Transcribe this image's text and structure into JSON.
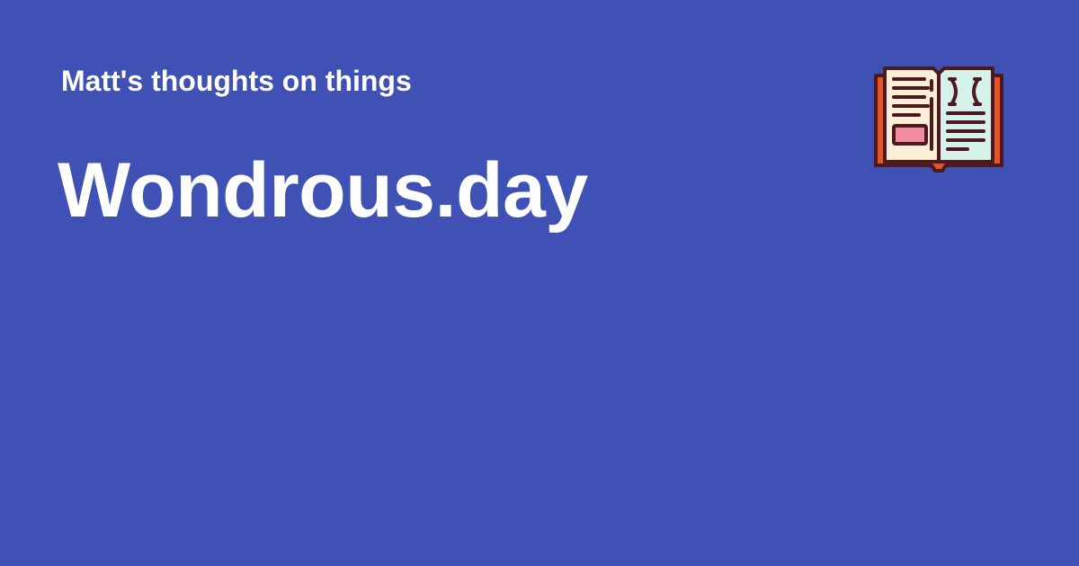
{
  "site": {
    "tagline": "Matt's thoughts on things",
    "title": "Wondrous.day"
  },
  "logo": {
    "icon": "open-book-icon"
  },
  "colors": {
    "background": "#3f51b5",
    "text": "#ffffff",
    "book_cover": "#e8542a",
    "book_outline": "#4a1a1f",
    "page_left": "#fbeed6",
    "page_right": "#d6f0ea",
    "highlight": "#f28aa0"
  }
}
